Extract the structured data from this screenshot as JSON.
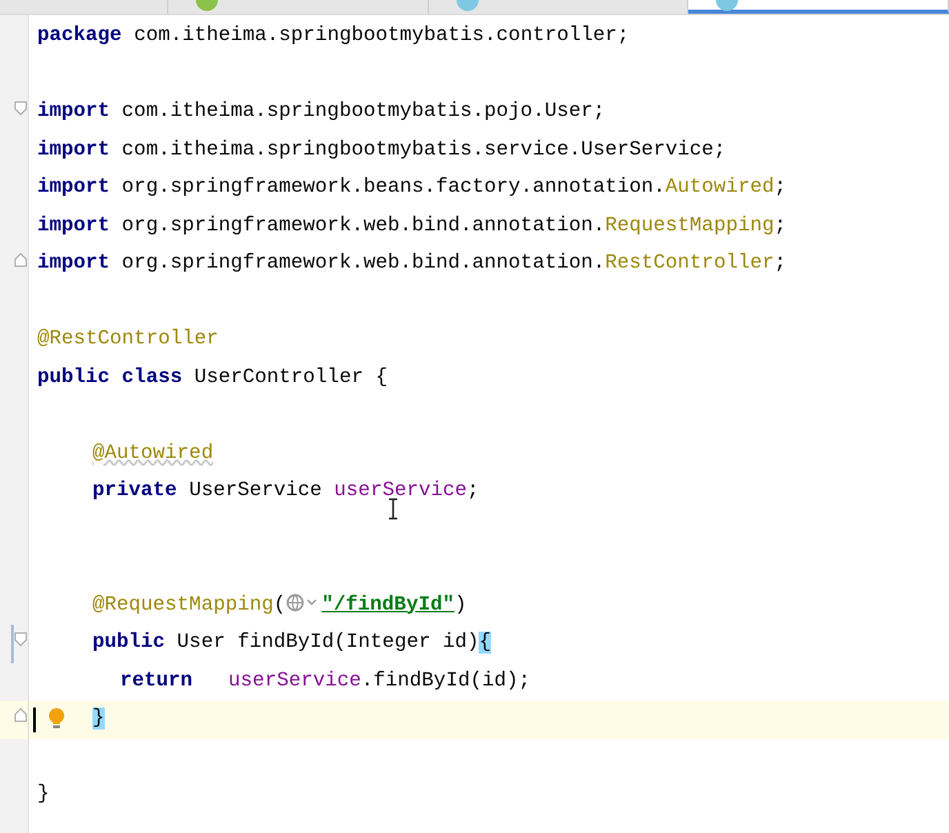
{
  "tabs": [
    {
      "color": "#8bc34a",
      "selected": false
    },
    {
      "color": "#7ec8e3",
      "selected": false
    },
    {
      "color": "#7ec8e3",
      "selected": true
    }
  ],
  "lines": [
    {
      "kind": "top",
      "tokens": [
        {
          "kind": "kw",
          "text": "package"
        },
        {
          "kind": "plain",
          "text": " com.itheima.springbootmybatis.controller;"
        }
      ]
    },
    {
      "kind": "blank"
    },
    {
      "kind": "top",
      "fold_start": true,
      "tokens": [
        {
          "kind": "kw",
          "text": "import"
        },
        {
          "kind": "plain",
          "text": " com.itheima.springbootmybatis.pojo.User;"
        }
      ]
    },
    {
      "kind": "top",
      "tokens": [
        {
          "kind": "kw",
          "text": "import"
        },
        {
          "kind": "plain",
          "text": " com.itheima.springbootmybatis.service.UserService;"
        }
      ]
    },
    {
      "kind": "top",
      "tokens": [
        {
          "kind": "kw",
          "text": "import"
        },
        {
          "kind": "plain",
          "text": " org.springframework.beans.factory.annotation."
        },
        {
          "kind": "ann",
          "text": "Autowired"
        },
        {
          "kind": "plain",
          "text": ";"
        }
      ]
    },
    {
      "kind": "top",
      "tokens": [
        {
          "kind": "kw",
          "text": "import"
        },
        {
          "kind": "plain",
          "text": " org.springframework.web.bind.annotation."
        },
        {
          "kind": "ann",
          "text": "RequestMapping"
        },
        {
          "kind": "plain",
          "text": ";"
        }
      ]
    },
    {
      "kind": "top",
      "fold_end": true,
      "tokens": [
        {
          "kind": "kw",
          "text": "import"
        },
        {
          "kind": "plain",
          "text": " org.springframework.web.bind.annotation."
        },
        {
          "kind": "ann",
          "text": "RestController"
        },
        {
          "kind": "plain",
          "text": ";"
        }
      ]
    },
    {
      "kind": "blank"
    },
    {
      "kind": "top",
      "tokens": [
        {
          "kind": "ann",
          "text": "@RestController"
        }
      ]
    },
    {
      "kind": "top",
      "tokens": [
        {
          "kind": "kw",
          "text": "public class"
        },
        {
          "kind": "plain",
          "text": " UserController {"
        }
      ]
    },
    {
      "kind": "blank"
    },
    {
      "kind": "member",
      "tokens": [
        {
          "kind": "ann",
          "text": "@Autowired",
          "warn": true
        }
      ]
    },
    {
      "kind": "member",
      "tokens": [
        {
          "kind": "kw",
          "text": "private"
        },
        {
          "kind": "plain",
          "text": " UserService "
        },
        {
          "kind": "field",
          "text": "userService"
        },
        {
          "kind": "plain",
          "text": ";"
        }
      ]
    },
    {
      "kind": "blank"
    },
    {
      "kind": "blank"
    },
    {
      "kind": "member",
      "tokens": [
        {
          "kind": "ann",
          "text": "@RequestMapping"
        },
        {
          "kind": "plain",
          "text": "("
        },
        {
          "kind": "globe"
        },
        {
          "kind": "str",
          "text": "\"/findById\""
        },
        {
          "kind": "plain",
          "text": ")"
        }
      ]
    },
    {
      "kind": "member",
      "fold_start": true,
      "changed": true,
      "tokens": [
        {
          "kind": "kw",
          "text": "public"
        },
        {
          "kind": "plain",
          "text": " User findById(Integer id)"
        },
        {
          "kind": "plain",
          "text": "{",
          "match": true
        }
      ]
    },
    {
      "kind": "body",
      "tokens": [
        {
          "kind": "kw",
          "text": "return"
        },
        {
          "kind": "field",
          "text": "userService",
          "gap": true
        },
        {
          "kind": "plain",
          "text": ".findById(id);"
        }
      ]
    },
    {
      "kind": "member",
      "fold_end": true,
      "current": true,
      "bulb": true,
      "tokens": [
        {
          "kind": "plain",
          "text": "}",
          "match": true
        }
      ]
    },
    {
      "kind": "blank"
    },
    {
      "kind": "top",
      "tokens": [
        {
          "kind": "plain",
          "text": "}"
        }
      ]
    }
  ]
}
